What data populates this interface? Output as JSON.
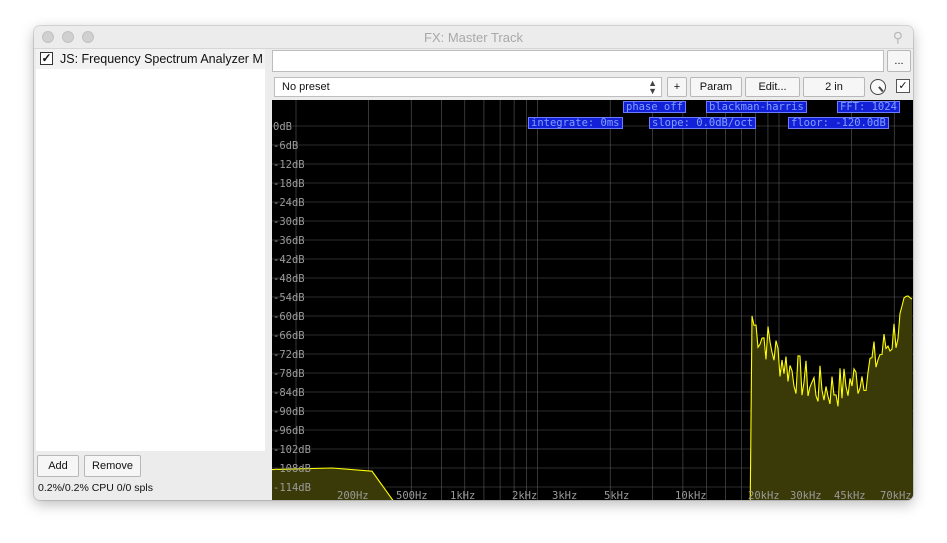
{
  "window": {
    "title": "FX: Master Track"
  },
  "fx_list": {
    "items": [
      {
        "label": "JS: Frequency Spectrum Analyzer M",
        "enabled": true
      }
    ],
    "add_label": "Add",
    "remove_label": "Remove",
    "cpu_status": "0.2%/0.2% CPU 0/0 spls"
  },
  "toolbar": {
    "more_label": "...",
    "preset_value": "No preset",
    "plus_label": "+",
    "param_label": "Param",
    "edit_label": "Edit...",
    "io_label": "2 in",
    "enable_mark": "✓"
  },
  "analyzer": {
    "settings": {
      "phase": "phase off",
      "window": "blackman-harris",
      "fft": "FFT: 1024",
      "integrate": "integrate: 0ms",
      "slope": "slope: 0.0dB/oct",
      "floor": "floor: -120.0dB"
    },
    "db_labels": [
      "0dB",
      "-6dB",
      "-12dB",
      "-18dB",
      "-24dB",
      "-30dB",
      "-36dB",
      "-42dB",
      "-48dB",
      "-54dB",
      "-60dB",
      "-66dB",
      "-72dB",
      "-78dB",
      "-84dB",
      "-90dB",
      "-96dB",
      "-102dB",
      "-108dB",
      "-114dB"
    ],
    "freq_labels": [
      "200Hz",
      "500Hz",
      "1kHz",
      "2kHz",
      "3kHz",
      "5kHz",
      "10kHz",
      "20kHz",
      "30kHz",
      "45kHz",
      "70kHz"
    ],
    "colors": {
      "background": "#000000",
      "grid": "#5a5a5a",
      "spectrum": "#ffff00",
      "spectrum_fill": "#3a3a08",
      "tag_bg": "#1420d8",
      "tag_text": "#7fa0ff"
    }
  }
}
